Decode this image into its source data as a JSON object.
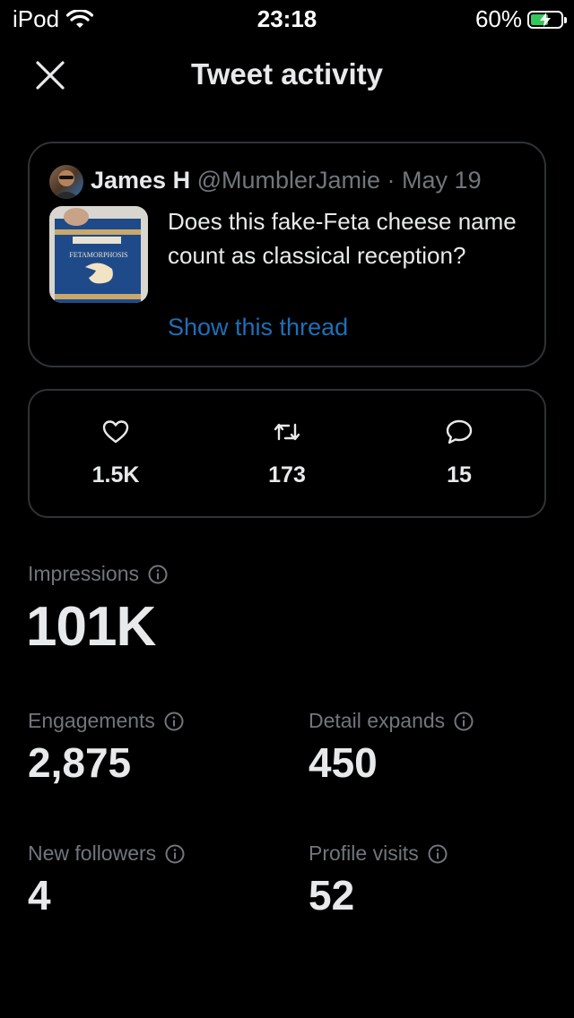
{
  "status_bar": {
    "carrier": "iPod",
    "time": "23:18",
    "battery": "60%",
    "battery_level": 0.6
  },
  "header": {
    "title": "Tweet activity",
    "close_icon": "close-icon"
  },
  "tweet": {
    "author_name": "James H",
    "handle_and_date": "@MumblerJamie · May 19",
    "text": "Does this fake-Feta cheese name count as classical reception?",
    "show_thread": "Show this thread",
    "thumbnail_label": "FETAMORPHOSIS"
  },
  "counts": {
    "likes": "1.5K",
    "retweets": "173",
    "replies": "15"
  },
  "metrics": {
    "impressions": {
      "label": "Impressions",
      "value": "101K"
    },
    "engagements": {
      "label": "Engagements",
      "value": "2,875"
    },
    "detail_expands": {
      "label": "Detail expands",
      "value": "450"
    },
    "new_followers": {
      "label": "New followers",
      "value": "4"
    },
    "profile_visits": {
      "label": "Profile visits",
      "value": "52"
    }
  },
  "colors": {
    "background": "#000000",
    "border": "#2f3336",
    "muted": "#71767b",
    "link": "#1d6fb8",
    "battery": "#34c759"
  }
}
